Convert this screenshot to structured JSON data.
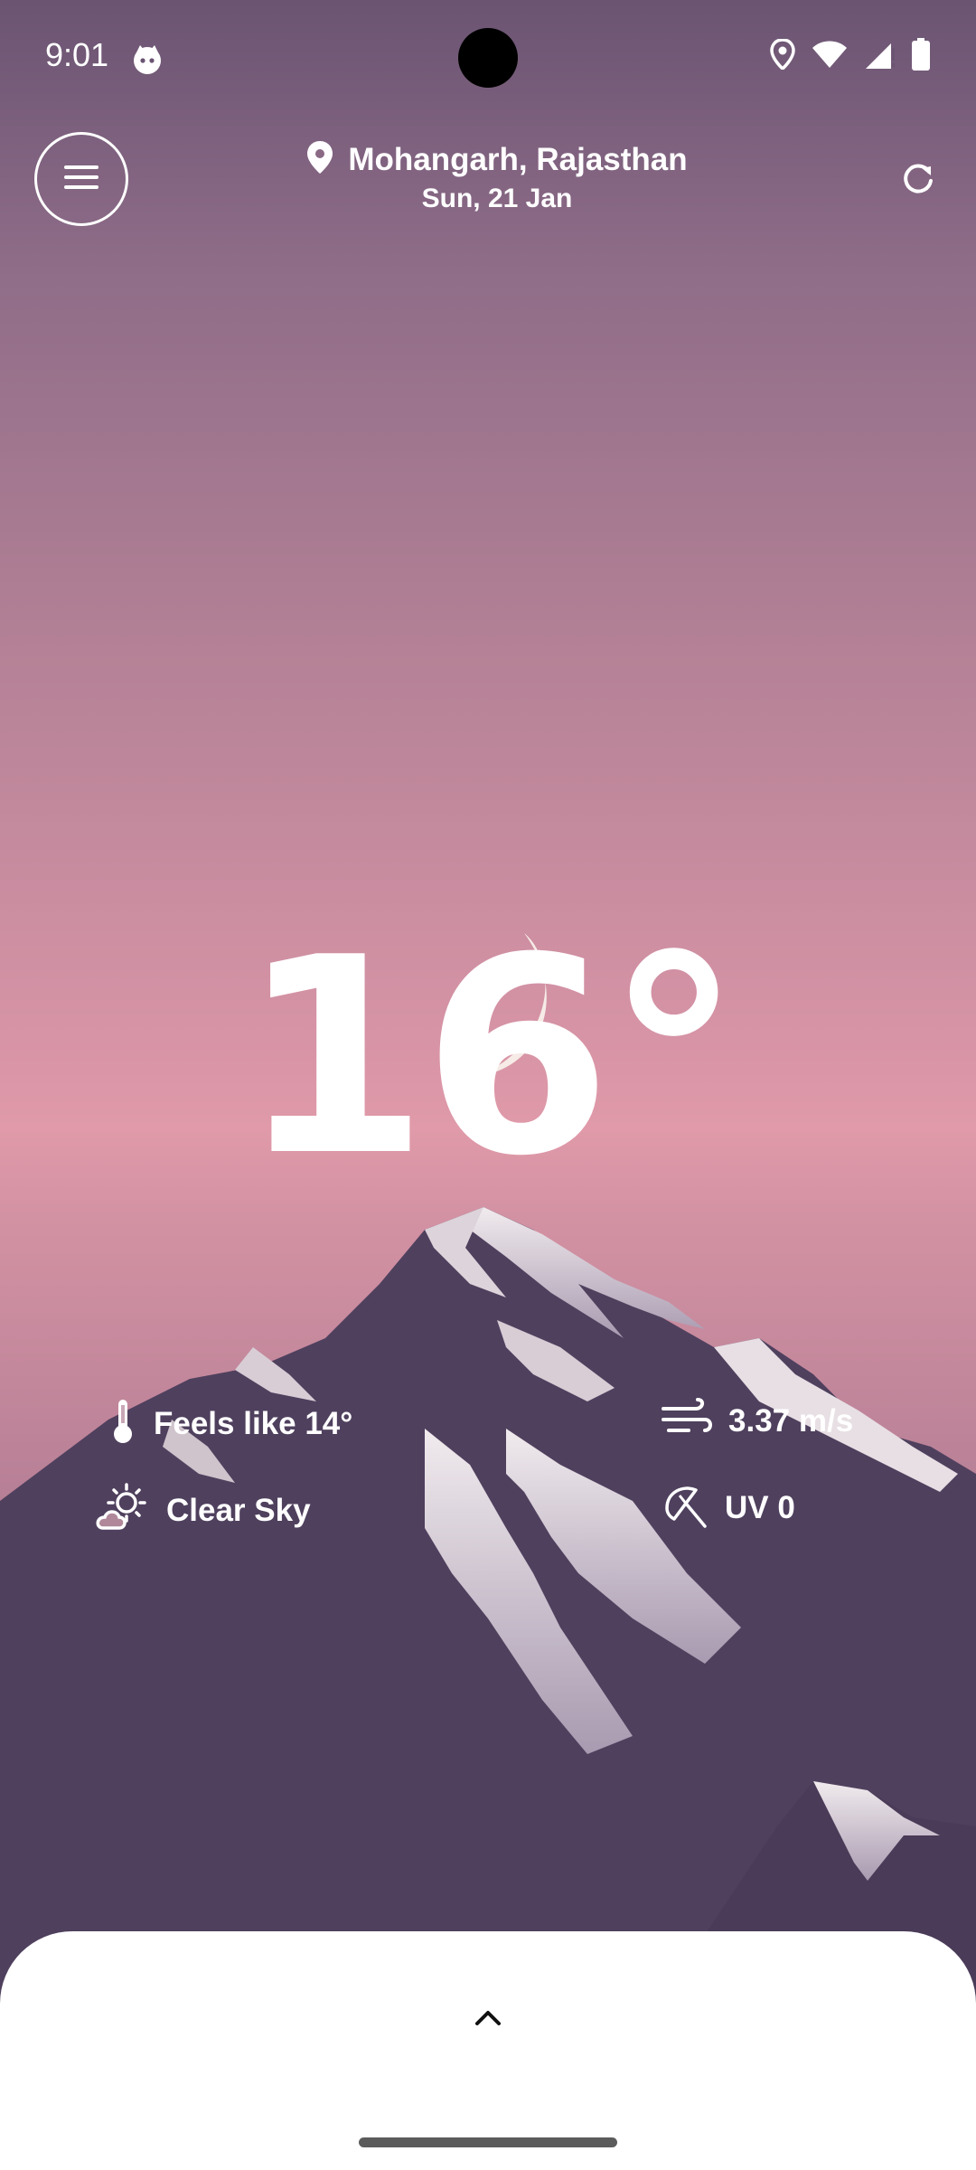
{
  "status_bar": {
    "time": "9:01",
    "icons": [
      "cat-app-icon",
      "location-icon",
      "wifi-icon",
      "signal-icon",
      "battery-icon"
    ]
  },
  "header": {
    "location": "Mohangarh, Rajasthan",
    "date": "Sun, 21 Jan",
    "icons": [
      "menu-icon",
      "location-pin-icon",
      "refresh-icon"
    ]
  },
  "weather": {
    "temperature": "16°",
    "condition_icon": "crescent-moon-icon",
    "details": {
      "feels_like": "Feels like 14°",
      "wind": "3.37 m/s",
      "condition": "Clear Sky",
      "uv": "UV 0"
    }
  },
  "bottom_sheet": {
    "icon": "chevron-up-icon"
  },
  "colors": {
    "sky_top": "#6a5472",
    "sky_mid": "#e09aa9",
    "mountain_dark": "#4f405e",
    "snow": "#e8e1e6",
    "sheet": "#ffffff"
  }
}
